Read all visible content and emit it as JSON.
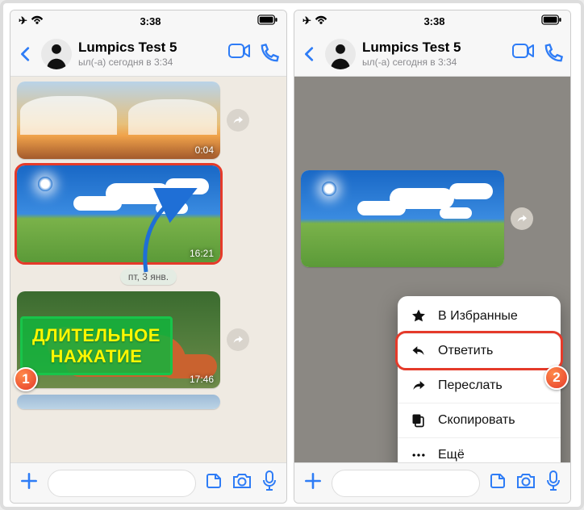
{
  "status": {
    "time": "3:38"
  },
  "header": {
    "title": "Lumpics Test 5",
    "subtitle": "ыл(-а) сегодня в 3:34"
  },
  "timestamps": {
    "msg1": "0:04",
    "msg2": "16:21",
    "msg3": "17:46"
  },
  "date_pill": "пт, 3 янв.",
  "annotation": {
    "line1": "ДЛИТЕЛЬНОЕ",
    "line2": "НАЖАТИЕ"
  },
  "badges": {
    "one": "1",
    "two": "2"
  },
  "menu": {
    "favorite": "В Избранные",
    "reply": "Ответить",
    "forward": "Переслать",
    "copy": "Скопировать",
    "more": "Ещё"
  }
}
